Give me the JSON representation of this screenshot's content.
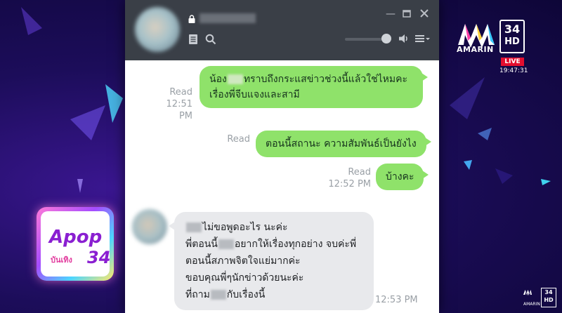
{
  "chat": {
    "messages": [
      {
        "direction": "out",
        "lines": [
          "น้อง",
          "ทราบถึงกระแสข่าวช่วงนี้แล้วใช่ไหมคะ",
          "เรื่องพี่จีบแจงและสามี"
        ],
        "status": "Read",
        "time": "12:51 PM"
      },
      {
        "direction": "out",
        "text": "ตอนนี้สถานะ ความสัมพันธ์เป็นยังไง",
        "status": "Read"
      },
      {
        "direction": "out",
        "text": "บ้างคะ",
        "status": "Read",
        "time": "12:52 PM"
      },
      {
        "direction": "in",
        "lines": [
          "ไม่ขอพูดอะไร นะค่ะ",
          "พี่ตอนนี้",
          "อยากให้เรื่องทุกอย่าง จบค่ะพี่",
          "ตอนนี้สภาพจิตใจแย่มากค่ะ",
          "ขอบคุณพี่ๆนักข่าวด้วยนะค่ะ",
          "ที่ถาม",
          "กับเรื่องนี้"
        ],
        "time": "12:53 PM"
      }
    ]
  },
  "broadcast": {
    "channel_name": "AMARIN",
    "channel_number": "34",
    "hd_label": "HD",
    "live_label": "LIVE",
    "live_time": "19:47:31",
    "show_logo_text": "Apop",
    "show_logo_sub": "บันเทิง",
    "show_logo_num": "34",
    "corner_num": "34",
    "corner_hd": "HD",
    "corner_name": "AMARIN"
  },
  "colors": {
    "bubble_out": "#8fe26a",
    "bubble_in": "#e8e9ec",
    "titlebar": "#3a3f47",
    "live_red": "#e30e2f"
  }
}
